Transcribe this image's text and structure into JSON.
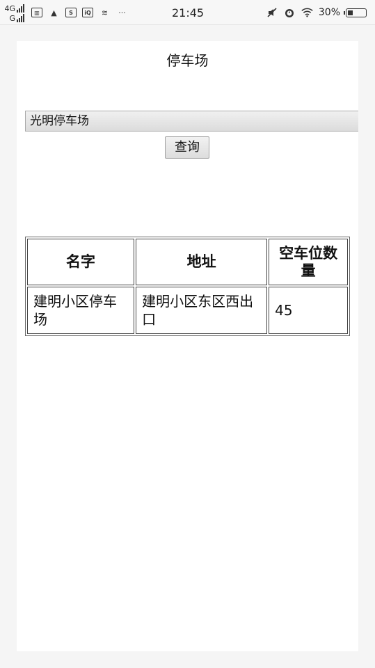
{
  "status_bar": {
    "network_top": "4G",
    "network_bottom": "G",
    "time": "21:45",
    "more": "···",
    "battery_text": "30%",
    "battery_level": 0.3,
    "icons": [
      "sim-card-icon",
      "warning-icon",
      "sogou-app-icon",
      "iqiyi-app-icon",
      "data-sync-icon",
      "mute-icon",
      "alarm-icon",
      "wifi-icon",
      "battery-icon"
    ]
  },
  "page": {
    "title": "停车场",
    "select": {
      "selected": "光明停车场"
    },
    "query_button": "查询",
    "table": {
      "headers": [
        "名字",
        "地址",
        "空车位数量"
      ],
      "rows": [
        [
          "建明小区停车场",
          "建明小区东区西出口",
          "45"
        ]
      ]
    }
  }
}
